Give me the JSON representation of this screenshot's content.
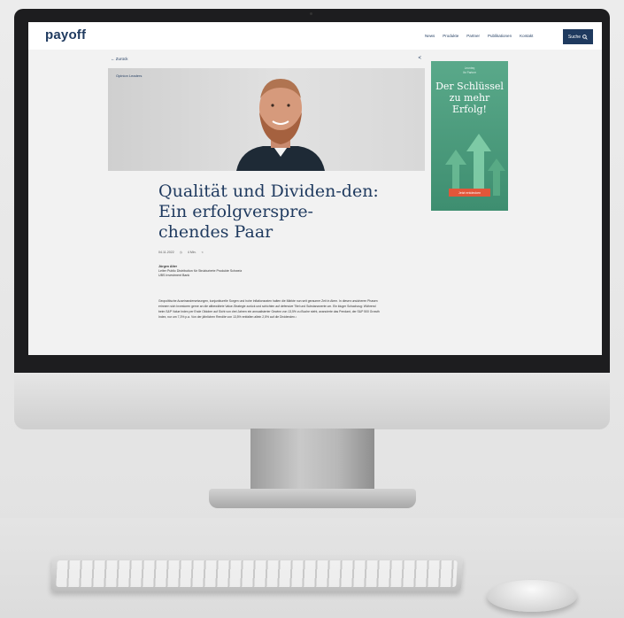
{
  "site": {
    "logo": "payoff",
    "nav": [
      "News",
      "Produkte",
      "Partner",
      "Publikationen",
      "Kontakt"
    ],
    "search_label": "Suche"
  },
  "article": {
    "back_label": "← Zurück",
    "category": "Opinion Leaders",
    "title": "Qualität und Dividen-den: Ein erfolgverspre-chendes Paar",
    "date": "04.11.2022",
    "read_time": "4 Min.",
    "author_name": "Jürgen Alter",
    "author_role": "Leiter Public Distribution für Strukturierte Produkte Schweiz",
    "author_company": "UBS Investment Bank",
    "body": "Geopolitische Auseinandersetzungen, konjunkturelle Sorgen und hohe Inflationsraten halten die Märkte nun seit geraumer Zeit in Atem. In diesen unsicheren Phasen erinnern sich Investoren gerne an die altbewährte Value-Strategie zurück und schichten auf defensive Titel und Substanzwerte um. Ein kluger Schachzug: Während beim S&P Value Index per Ende Oktober auf Sicht von drei Jahren ein annualisierter Gewinn von 13,5% zu Buche steht, avancierte das Pendant, der S&P 500 Growth Index, nur um 7,3% p.a. Von der jährlichen Rendite von 13,5% entfallen allein 2,5% auf die Dividenden.¹"
  },
  "ad": {
    "sponsor": "Leonteq",
    "tagline": "Ihr Partner",
    "headline": "Der Schlüssel zu mehr Erfolg!",
    "cta": "Jetzt entdecken"
  },
  "colors": {
    "brand": "#1f3a5f",
    "ad_green": "#4c9c7d",
    "cta_orange": "#e2563a"
  }
}
